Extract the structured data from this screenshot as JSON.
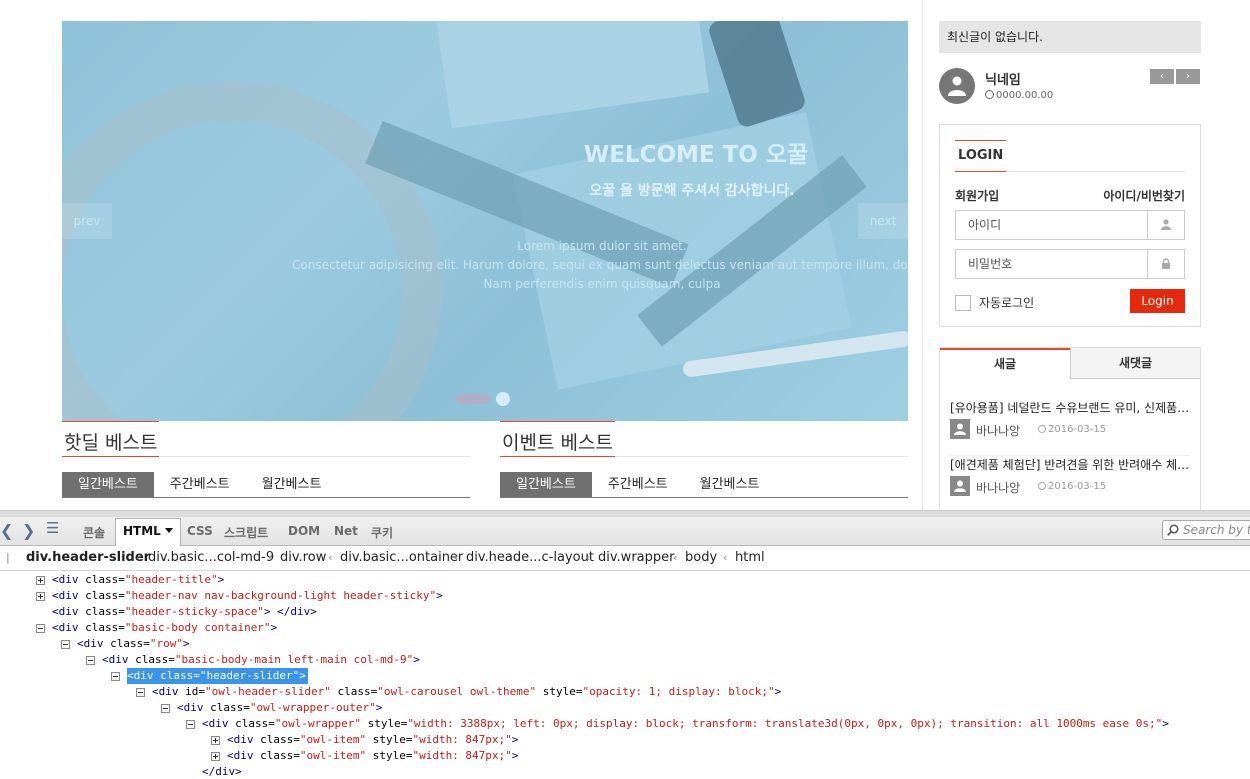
{
  "slider": {
    "title": "WELCOME TO 오꿀",
    "subtitle": "오꿀 을 방문해 주셔서 감사합니다.",
    "lorem1": "Lorem ipsum dulor sit amet.",
    "lorem2": "Consectetur adipisicing elit. Harum dolore, sequi ex quam sunt delectus veniam aut tempore illum, dolor nem",
    "lorem3": "Nam perferendis enim quisquam, culpa",
    "prev": "prev",
    "next": "next"
  },
  "best_hot": {
    "title": "핫딜 베스트",
    "tabs": [
      "일간베스트",
      "주간베스트",
      "월간베스트"
    ]
  },
  "best_event": {
    "title": "이벤트 베스트",
    "tabs": [
      "일간베스트",
      "주간베스트",
      "월간베스트"
    ]
  },
  "sidebar": {
    "notice": "최신글이 없습니다.",
    "nickname": "닉네임",
    "date": "0000.00.00",
    "pager_prev": "‹",
    "pager_next": "›"
  },
  "login": {
    "heading": "LOGIN",
    "signup": "회원가입",
    "find": "아이디/비번찾기",
    "id_placeholder": "아이디",
    "pw_placeholder": "비밀번호",
    "auto_login": "자동로그인",
    "button": "Login"
  },
  "news": {
    "tabs": [
      "새글",
      "새댓글"
    ],
    "items": [
      {
        "title": "[유아용품] 네덜란드 수유브랜드 유미, 신제품 출시",
        "author": "바나나앙",
        "date": "2016-03-15"
      },
      {
        "title": "[애견제품 체험단] 반려견을 위한 반려애수 체험단 모집",
        "author": "바나나앙",
        "date": "2016-03-15"
      }
    ]
  },
  "devtools": {
    "tabs": [
      "콘솔",
      "HTML",
      "CSS",
      "스크립트",
      "DOM",
      "Net",
      "쿠키"
    ],
    "search_placeholder": "Search by text",
    "breadcrumbs": [
      "div.header-slider",
      "div.basic...col-md-9",
      "div.row",
      "div.basic...ontainer",
      "div.heade...c-layout",
      "div.wrapper",
      "body",
      "html"
    ],
    "tree": [
      {
        "toggle": "plus",
        "tag": "div",
        "attrs": [
          [
            "class",
            "header-title"
          ]
        ],
        "close": false
      },
      {
        "toggle": "plus",
        "tag": "div",
        "attrs": [
          [
            "class",
            "header-nav nav-background-light header-sticky"
          ]
        ],
        "close": false
      },
      {
        "toggle": "none",
        "tag": "div",
        "attrs": [
          [
            "class",
            "header-sticky-space"
          ]
        ],
        "close": true
      },
      {
        "toggle": "minus",
        "tag": "div",
        "attrs": [
          [
            "class",
            "basic-body container"
          ]
        ],
        "close": false
      },
      {
        "toggle": "minus",
        "tag": "div",
        "attrs": [
          [
            "class",
            "row"
          ]
        ],
        "close": false
      },
      {
        "toggle": "minus",
        "tag": "div",
        "attrs": [
          [
            "class",
            "basic-body-main left-main col-md-9"
          ]
        ],
        "close": false
      },
      {
        "toggle": "minus",
        "tag": "div",
        "attrs": [
          [
            "class",
            "header-slider"
          ]
        ],
        "close": false,
        "selected": true
      },
      {
        "toggle": "minus",
        "tag": "div",
        "attrs": [
          [
            "id",
            "owl-header-slider"
          ],
          [
            "class",
            "owl-carousel owl-theme"
          ],
          [
            "style",
            "opacity: 1; display: block;"
          ]
        ],
        "close": false
      },
      {
        "toggle": "minus",
        "tag": "div",
        "attrs": [
          [
            "class",
            "owl-wrapper-outer"
          ]
        ],
        "close": false
      },
      {
        "toggle": "minus",
        "tag": "div",
        "attrs": [
          [
            "class",
            "owl-wrapper"
          ],
          [
            "style",
            "width: 3388px; left: 0px; display: block; transform: translate3d(0px, 0px, 0px); transition: all 1000ms ease 0s;"
          ]
        ],
        "close": false
      },
      {
        "toggle": "plus",
        "tag": "div",
        "attrs": [
          [
            "class",
            "owl-item"
          ],
          [
            "style",
            "width: 847px;"
          ]
        ],
        "close": false
      },
      {
        "toggle": "plus",
        "tag": "div",
        "attrs": [
          [
            "class",
            "owl-item"
          ],
          [
            "style",
            "width: 847px;"
          ]
        ],
        "close": false
      },
      {
        "toggle": "none",
        "tag": "/div",
        "attrs": [],
        "close": false
      }
    ]
  }
}
